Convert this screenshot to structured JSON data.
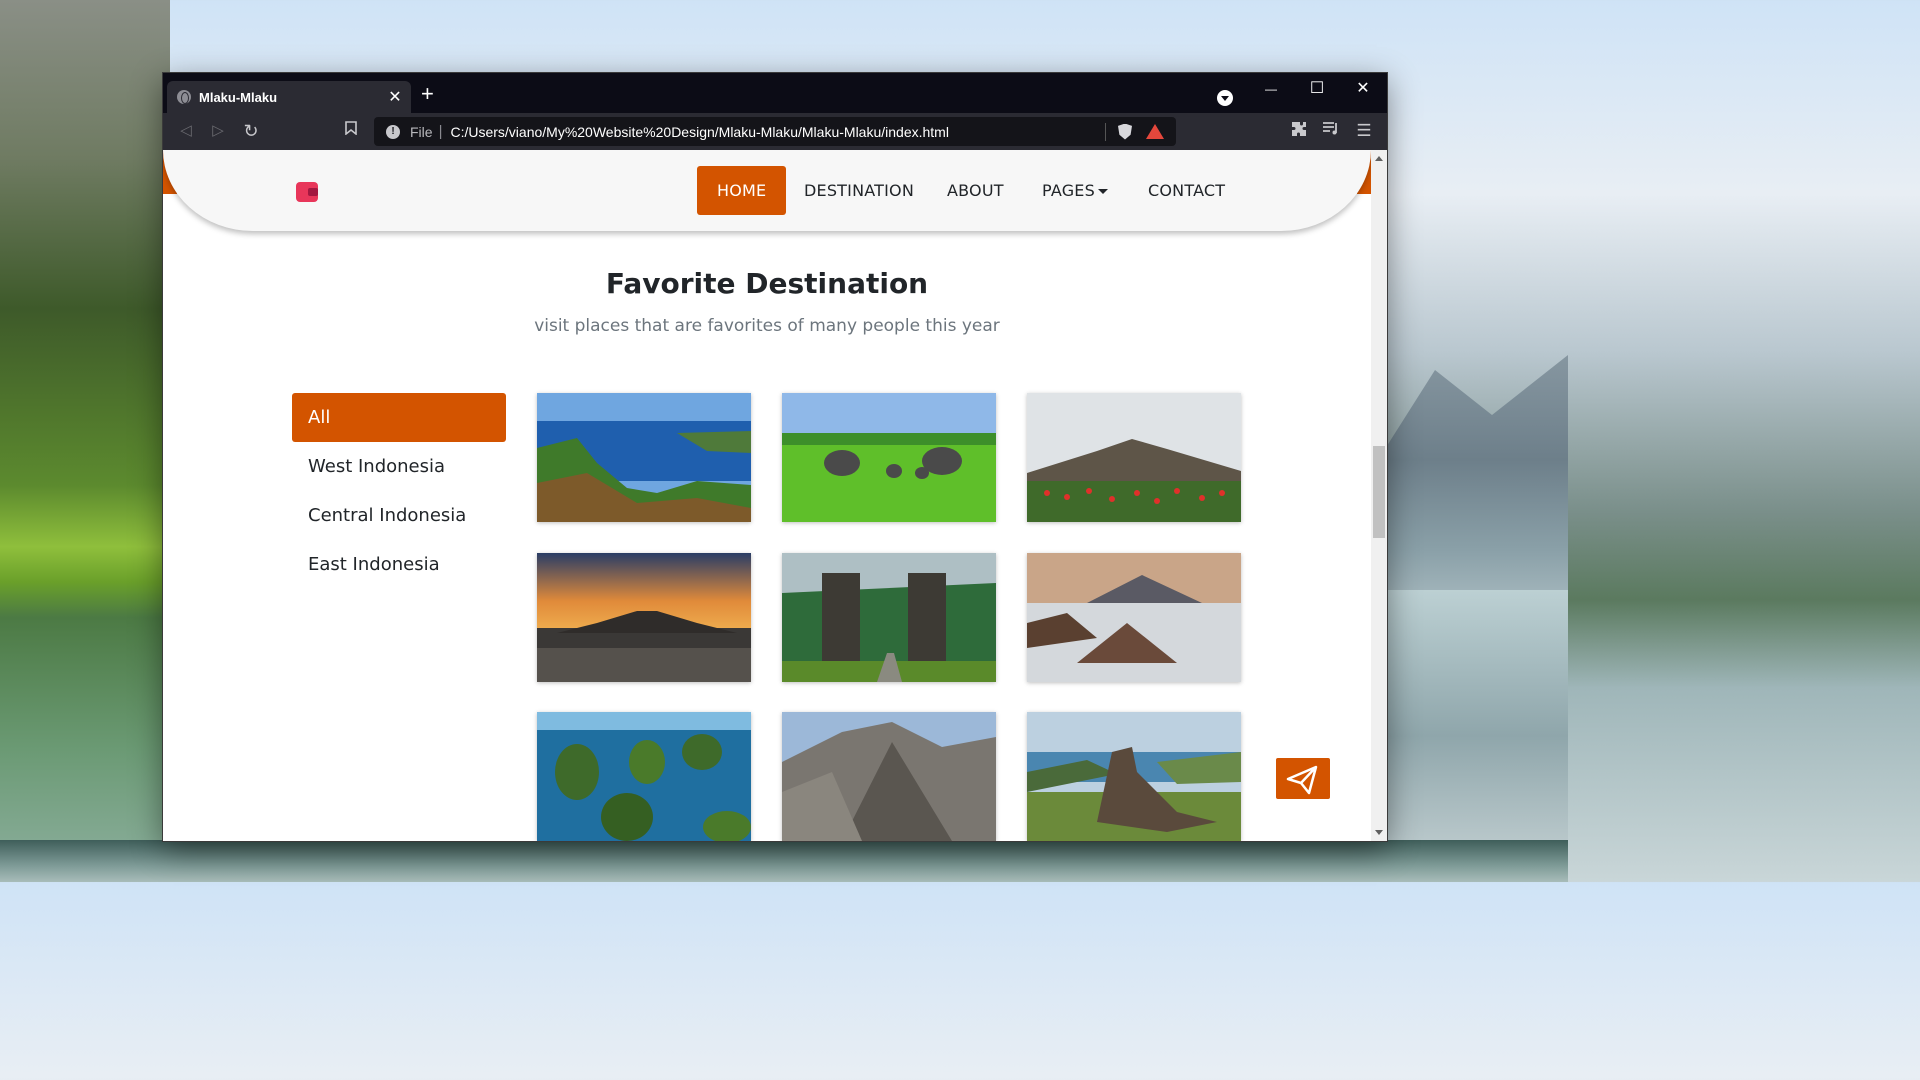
{
  "browser": {
    "tab_title": "Mlaku-Mlaku",
    "tab_close": "✕",
    "new_tab": "+",
    "address": {
      "file_label": "File",
      "url": "C:/Users/viano/My%20Website%20Design/Mlaku-Mlaku/Mlaku-Mlaku/index.html"
    },
    "window_controls": {
      "minimize": "—",
      "maximize": "☐",
      "close": "✕"
    },
    "icons": [
      "back-icon",
      "forward-icon",
      "reload-icon",
      "bookmark-icon",
      "info-icon",
      "brave-shield-icon",
      "brave-rewards-icon",
      "extensions-icon",
      "playlist-icon",
      "menu-icon"
    ]
  },
  "site": {
    "nav": {
      "items": [
        {
          "label": "HOME",
          "active": true
        },
        {
          "label": "DESTINATION",
          "active": false
        },
        {
          "label": "ABOUT",
          "active": false
        },
        {
          "label": "PAGES",
          "active": false,
          "dropdown": true
        },
        {
          "label": "CONTACT",
          "active": false
        }
      ]
    },
    "section": {
      "title": "Favorite Destination",
      "subtitle": "visit places that are favorites of many people this year"
    },
    "filters": [
      {
        "label": "All",
        "active": true
      },
      {
        "label": "West Indonesia",
        "active": false
      },
      {
        "label": "Central Indonesia",
        "active": false
      },
      {
        "label": "East Indonesia",
        "active": false
      }
    ],
    "gallery": [
      {
        "scene": "lake-toba"
      },
      {
        "scene": "elephants"
      },
      {
        "scene": "mountain-flowers"
      },
      {
        "scene": "borobudur"
      },
      {
        "scene": "bali-gate"
      },
      {
        "scene": "bromo"
      },
      {
        "scene": "raja-ampat"
      },
      {
        "scene": "cartensz"
      },
      {
        "scene": "komodo"
      }
    ],
    "accent_color": "#d35400"
  }
}
